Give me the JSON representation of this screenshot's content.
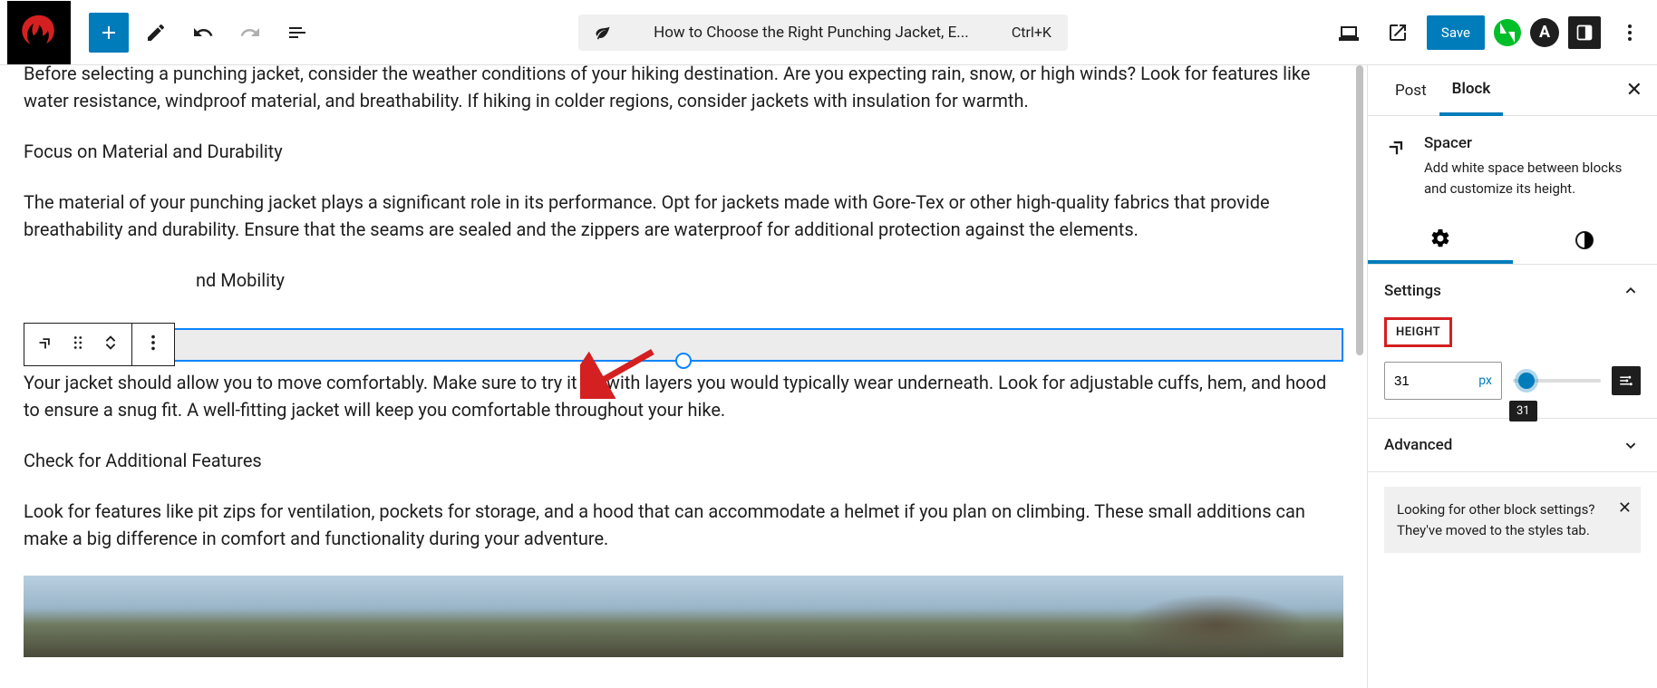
{
  "topbar": {
    "title": "How to Choose the Right Punching Jacket, E...",
    "shortcut": "Ctrl+K",
    "save": "Save",
    "astra": "A"
  },
  "content": {
    "p1": "Before selecting a punching jacket, consider the weather conditions of your hiking destination. Are you expecting rain, snow, or high winds? Look for features like water resistance, windproof material, and breathability. If hiking in colder regions, consider jackets with insulation for warmth.",
    "h2": "Focus on Material and Durability",
    "p2": "The material of your punching jacket plays a significant role in its performance. Opt for jackets made with Gore-Tex or other high-quality fabrics that provide breathability and durability. Ensure that the seams are sealed and the zippers are waterproof for additional protection against the elements.",
    "h3_frag": "nd Mobility",
    "p3": "Your jacket should allow you to move comfortably. Make sure to try it on with layers you would typically wear underneath. Look for adjustable cuffs, hem, and hood to ensure a snug fit. A well-fitting jacket will keep you comfortable throughout your hike.",
    "h4": "Check for Additional Features",
    "p4": "Look for features like pit zips for ventilation, pockets for storage, and a hood that can accommodate a helmet if you plan on climbing. These small additions can make a big difference in comfort and functionality during your adventure."
  },
  "sidebar": {
    "tab_post": "Post",
    "tab_block": "Block",
    "block_name": "Spacer",
    "block_desc": "Add white space between blocks and customize its height.",
    "settings_title": "Settings",
    "height_label": "HEIGHT",
    "height_value": "31",
    "height_unit": "px",
    "height_tooltip": "31",
    "advanced_title": "Advanced",
    "notice": "Looking for other block settings? They've moved to the styles tab."
  }
}
